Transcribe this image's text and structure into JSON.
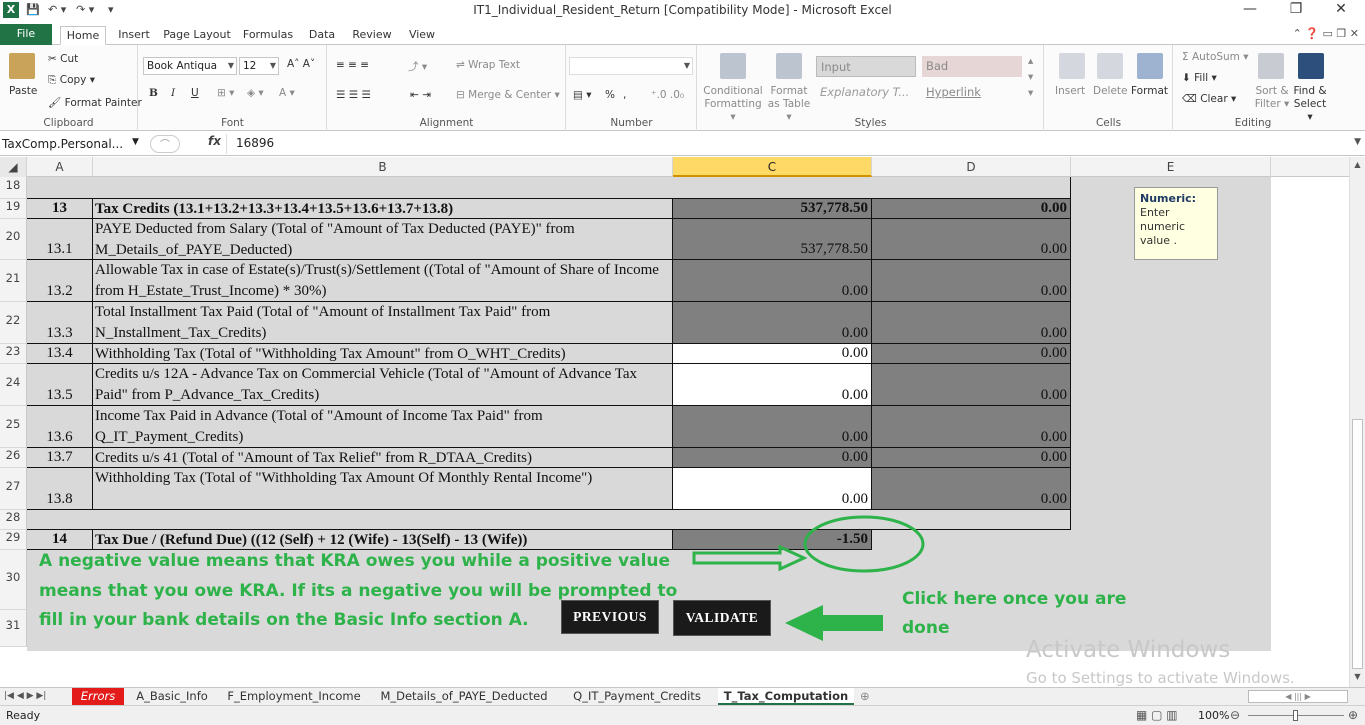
{
  "window": {
    "title": "IT1_Individual_Resident_Return  [Compatibility Mode]  -  Microsoft Excel",
    "app_icon": "X",
    "minimize": "—",
    "restore": "❐",
    "close": "✕"
  },
  "quick_access": {
    "save": "💾",
    "undo": "↶ ▾",
    "redo": "↷ ▾",
    "customize": "▾"
  },
  "ribbon_tabs": [
    "File",
    "Home",
    "Insert",
    "Page Layout",
    "Formulas",
    "Data",
    "Review",
    "View"
  ],
  "ribbon": {
    "clipboard": {
      "label": "Clipboard",
      "paste": "Paste",
      "cut": "Cut",
      "copy": "Copy ▾",
      "format_painter": "Format Painter"
    },
    "font": {
      "label": "Font",
      "name": "Book Antiqua",
      "size": "12",
      "bold": "B",
      "italic": "I",
      "underline": "U"
    },
    "alignment": {
      "label": "Alignment",
      "wrap_text": "Wrap Text",
      "merge_center": "Merge & Center ▾"
    },
    "number": {
      "label": "Number",
      "format": "",
      "percent": "%",
      "comma": ","
    },
    "styles": {
      "label": "Styles",
      "conditional_formatting": "Conditional Formatting ▾",
      "format_as_table": "Format as Table ▾",
      "input": "Input",
      "bad": "Bad",
      "explanatory": "Explanatory T...",
      "hyperlink": "Hyperlink"
    },
    "cells": {
      "label": "Cells",
      "insert": "Insert",
      "delete": "Delete",
      "format": "Format"
    },
    "editing": {
      "label": "Editing",
      "autosum": "AutoSum ▾",
      "fill": "Fill ▾",
      "clear": "Clear ▾",
      "sort_filter": "Sort & Filter ▾",
      "find_select": "Find & Select ▾"
    }
  },
  "formula_bar": {
    "name_box": "TaxComp.Personal...",
    "fx": "fx",
    "value": "16896"
  },
  "columns": [
    "A",
    "B",
    "C",
    "D",
    "E"
  ],
  "rows": [
    {
      "row": "18",
      "num": "",
      "desc": "",
      "c": "",
      "d": ""
    },
    {
      "row": "19",
      "num": "13",
      "desc": "Tax Credits (13.1+13.2+13.3+13.4+13.5+13.6+13.7+13.8)",
      "c": "537,778.50",
      "d": "0.00"
    },
    {
      "row": "20",
      "num": "13.1",
      "desc": "PAYE Deducted from Salary (Total of \"Amount of Tax Deducted (PAYE)\" from M_Details_of_PAYE_Deducted)",
      "c": "537,778.50",
      "d": "0.00"
    },
    {
      "row": "21",
      "num": "13.2",
      "desc": "Allowable Tax in case of Estate(s)/Trust(s)/Settlement ((Total of \"Amount of Share of Income from H_Estate_Trust_Income) * 30%)",
      "c": "0.00",
      "d": "0.00"
    },
    {
      "row": "22",
      "num": "13.3",
      "desc": "Total Installment Tax Paid (Total of \"Amount of Installment Tax Paid\" from N_Installment_Tax_Credits)",
      "c": "0.00",
      "d": "0.00"
    },
    {
      "row": "23",
      "num": "13.4",
      "desc": "Withholding Tax (Total of \"Withholding Tax Amount\" from O_WHT_Credits)",
      "c": "0.00",
      "d": "0.00"
    },
    {
      "row": "24",
      "num": "13.5",
      "desc": "Credits u/s 12A - Advance Tax on Commercial Vehicle (Total of \"Amount of Advance Tax Paid\" from P_Advance_Tax_Credits)",
      "c": "0.00",
      "d": "0.00"
    },
    {
      "row": "25",
      "num": "13.6",
      "desc": "Income Tax Paid in Advance (Total of \"Amount of Income Tax Paid\" from Q_IT_Payment_Credits)",
      "c": "0.00",
      "d": "0.00"
    },
    {
      "row": "26",
      "num": "13.7",
      "desc": "Credits u/s 41 (Total of \"Amount of Tax Relief\" from R_DTAA_Credits)",
      "c": "0.00",
      "d": "0.00"
    },
    {
      "row": "27",
      "num": "13.8",
      "desc": " Withholding Tax (Total of \"Withholding Tax Amount Of Monthly Rental Income\")",
      "c": "0.00",
      "d": "0.00"
    },
    {
      "row": "28",
      "num": "",
      "desc": "",
      "c": "",
      "d": ""
    },
    {
      "row": "29",
      "num": "14",
      "desc": "Tax Due / (Refund Due) ((12 (Self) + 12 (Wife) - 13(Self) - 13 (Wife))",
      "c": "-1.50",
      "d": ""
    },
    {
      "row": "30"
    },
    {
      "row": "31"
    }
  ],
  "annotations": {
    "note_line1": "A negative value means that KRA owes you while a positive value",
    "note_line2": "means that you owe KRA. If its a negative you will be prompted to",
    "note_line3": "fill in your bank details on the Basic Info section A.",
    "click_line1": "Click here once you are",
    "click_line2": "done",
    "accent_color": "#2db34a"
  },
  "buttons": {
    "previous": "PREVIOUS",
    "validate": "VALIDATE"
  },
  "tooltip": {
    "title": "Numeric:",
    "text": "Enter numeric value ."
  },
  "watermark": {
    "line1": "Activate Windows",
    "line2": "Go to Settings to activate Windows."
  },
  "sheet_tabs": [
    "Errors",
    "A_Basic_Info",
    "F_Employment_Income",
    "M_Details_of_PAYE_Deducted",
    "Q_IT_Payment_Credits",
    "T_Tax_Computation"
  ],
  "active_sheet": "T_Tax_Computation",
  "status": {
    "ready": "Ready",
    "zoom": "100%"
  }
}
